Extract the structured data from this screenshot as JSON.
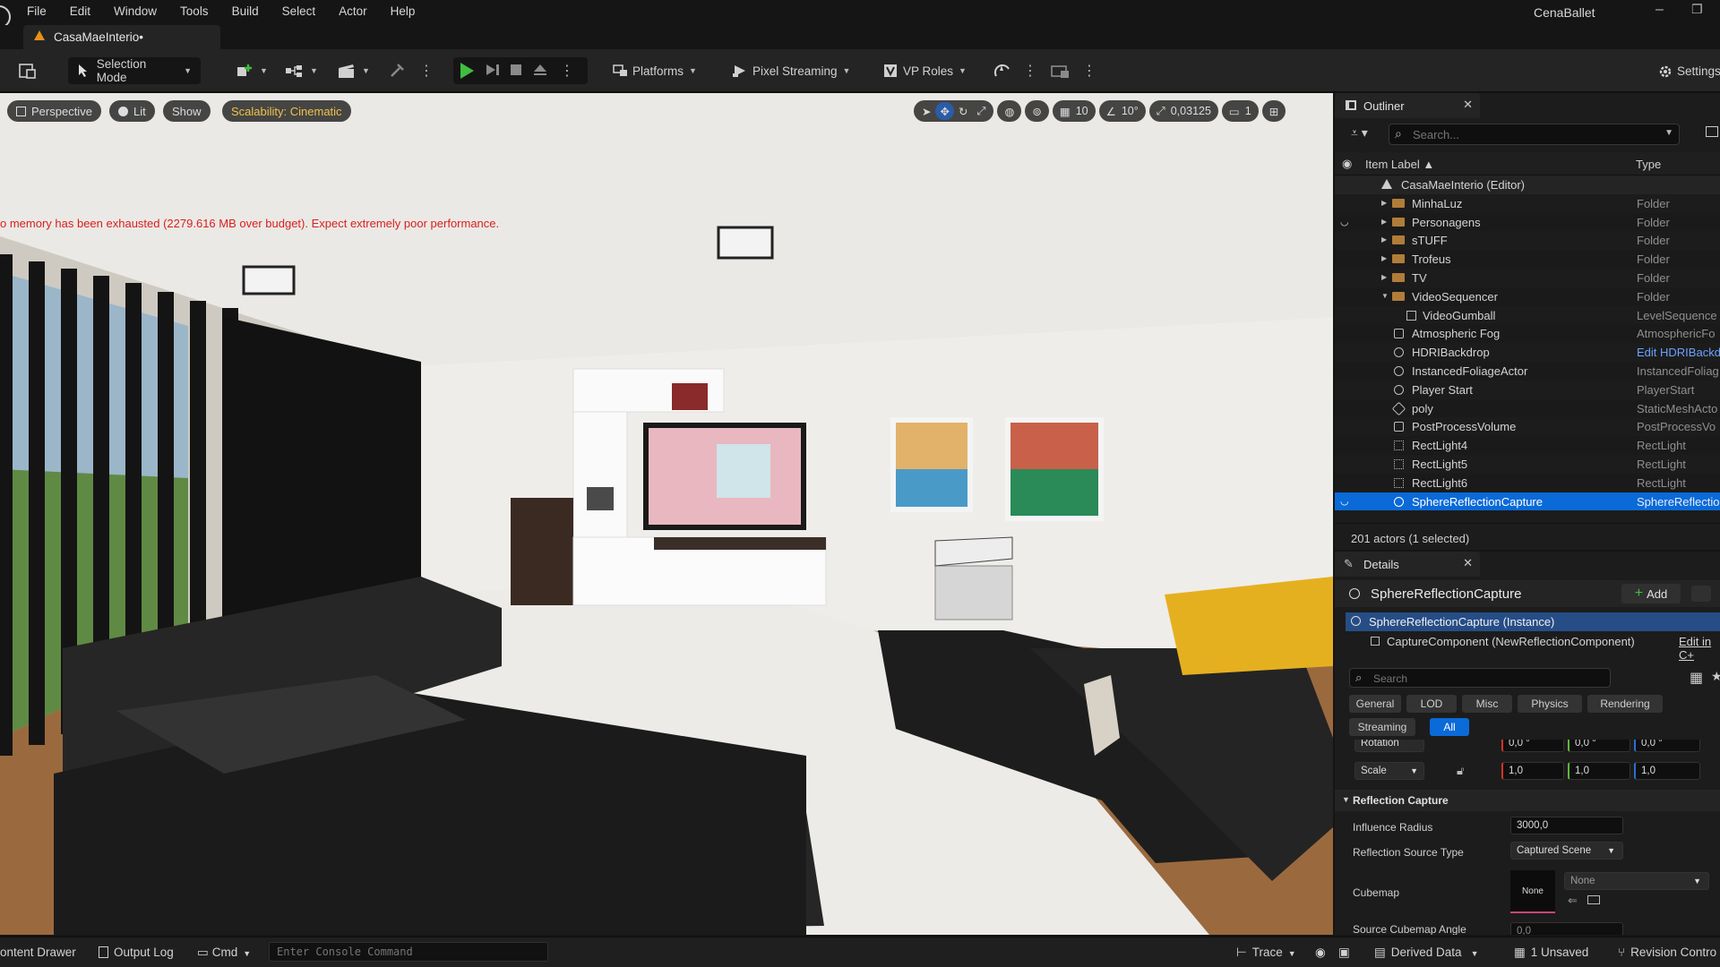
{
  "app": {
    "menu": [
      "File",
      "Edit",
      "Window",
      "Tools",
      "Build",
      "Select",
      "Actor",
      "Help"
    ],
    "project_name": "CenaBallet",
    "document_tab": "CasaMaeInterio•"
  },
  "toolbar": {
    "selection_mode": "Selection Mode",
    "platforms": "Platforms",
    "pixel_streaming": "Pixel Streaming",
    "vp_roles": "VP Roles",
    "settings": "Settings"
  },
  "viewport": {
    "perspective": "Perspective",
    "lit": "Lit",
    "show": "Show",
    "scalability": "Scalability: Cinematic",
    "grid_value": "10",
    "angle_value": "10°",
    "scale_value": "0,03125",
    "camera_speed": "1",
    "warning": "o memory has been exhausted (2279.616 MB over budget). Expect extremely poor performance."
  },
  "outliner": {
    "tab_label": "Outliner",
    "search_placeholder": "Search...",
    "col_label": "Item Label ▲",
    "col_type": "Type",
    "root": "CasaMaeInterio (Editor)",
    "rows": [
      {
        "label": "MinhaLuz",
        "type": "Folder"
      },
      {
        "label": "Personagens",
        "type": "Folder"
      },
      {
        "label": "sTUFF",
        "type": "Folder"
      },
      {
        "label": "Trofeus",
        "type": "Folder"
      },
      {
        "label": "TV",
        "type": "Folder"
      },
      {
        "label": "VideoSequencer",
        "type": "Folder"
      },
      {
        "label": "VideoGumball",
        "type": "LevelSequence"
      },
      {
        "label": "Atmospheric Fog",
        "type": "AtmosphericFo"
      },
      {
        "label": "HDRIBackdrop",
        "type": "Edit HDRIBackd"
      },
      {
        "label": "InstancedFoliageActor",
        "type": "InstancedFoliag"
      },
      {
        "label": "Player Start",
        "type": "PlayerStart"
      },
      {
        "label": "poly",
        "type": "StaticMeshActo"
      },
      {
        "label": "PostProcessVolume",
        "type": "PostProcessVo"
      },
      {
        "label": "RectLight4",
        "type": "RectLight"
      },
      {
        "label": "RectLight5",
        "type": "RectLight"
      },
      {
        "label": "RectLight6",
        "type": "RectLight"
      },
      {
        "label": "SphereReflectionCapture",
        "type": "SphereReflectio"
      }
    ],
    "footer": "201 actors (1 selected)"
  },
  "details": {
    "tab_label": "Details",
    "object_name": "SphereReflectionCapture",
    "add_label": "Add",
    "instance_label": "SphereReflectionCapture (Instance)",
    "component_label": "CaptureComponent (NewReflectionComponent)",
    "edit_cpp": "Edit in C+",
    "search_placeholder": "Search",
    "categories": [
      "General",
      "LOD",
      "Misc",
      "Physics",
      "Rendering",
      "Streaming",
      "All"
    ],
    "rotation_label": "Rotation",
    "rotation": [
      "0,0 °",
      "0,0 °",
      "0,0 °"
    ],
    "scale_label": "Scale",
    "scale": [
      "1,0",
      "1,0",
      "1,0"
    ],
    "section": "Reflection Capture",
    "influence_radius_label": "Influence Radius",
    "influence_radius": "3000,0",
    "source_type_label": "Reflection Source Type",
    "source_type": "Captured Scene",
    "cubemap_label": "Cubemap",
    "cubemap_thumb": "None",
    "cubemap_value": "None",
    "source_angle_label": "Source Cubemap Angle",
    "source_angle": "0,0"
  },
  "statusbar": {
    "content_drawer": "ontent Drawer",
    "output_log": "Output Log",
    "cmd": "Cmd",
    "console_placeholder": "Enter Console Command",
    "trace": "Trace",
    "derived_data": "Derived Data",
    "unsaved": "1 Unsaved",
    "revision_control": "Revision Contro"
  }
}
